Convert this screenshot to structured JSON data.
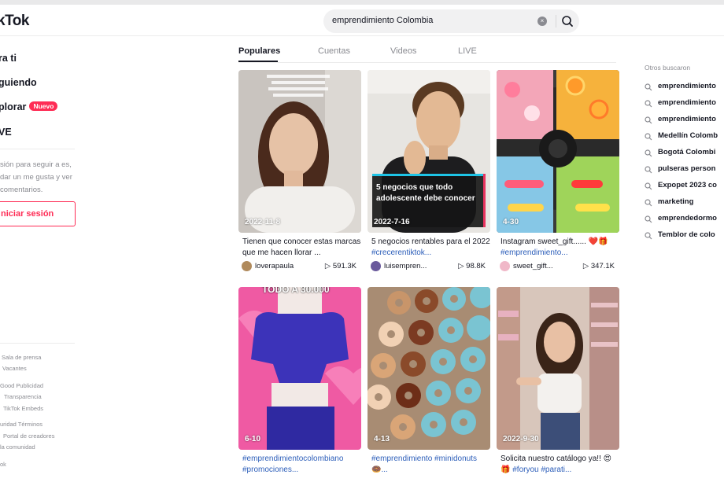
{
  "header": {
    "logo": "kTok",
    "search_value": "emprendimiento Colombia",
    "clear_glyph": "×"
  },
  "sidebar": {
    "nav": [
      {
        "label": "ra ti"
      },
      {
        "label": "guiendo"
      },
      {
        "label": "plorar",
        "badge": "Nuevo"
      },
      {
        "label": "VE"
      }
    ],
    "login_text": "sión para seguir a es, dar un me gusta y ver comentarios.",
    "login_button": "niciar sesión",
    "footer": [
      "Sala de prensa",
      "Vacantes",
      "Good Publicidad",
      "Transparencia",
      "TikTok Embeds",
      "uridad Términos",
      "Portal de creadores",
      "la comunidad",
      "ok"
    ]
  },
  "tabs": [
    {
      "label": "Populares",
      "active": true
    },
    {
      "label": "Cuentas",
      "active": false
    },
    {
      "label": "Videos",
      "active": false
    },
    {
      "label": "LIVE",
      "active": false
    }
  ],
  "cards": [
    {
      "date": "2022-11-8",
      "desc": "Tienen que conocer estas marcas que me hacen llorar ...",
      "author": "loverapaula",
      "views": "591.3K",
      "avatar_color": "#b08a5c"
    },
    {
      "date": "2022-7-16",
      "desc": "5 negocios rentables para el 2022 ",
      "desc_tag": "#crecerentiktok...",
      "author": "luisempren...",
      "views": "98.8K",
      "avatar_color": "#6a5a9c",
      "overlay": "5 negocios que todo adolescente debe conocer"
    },
    {
      "date": "4-30",
      "desc": "Instagram sweet_gift...... ❤️🎁 ",
      "desc_tag": "#emprendimiento...",
      "author": "sweet_gift...",
      "views": "347.1K",
      "avatar_color": "#f0b8c8"
    },
    {
      "date": "6-10",
      "desc": "",
      "desc_tag": "#emprendimientocolombiano #promociones...",
      "author": "",
      "views": "",
      "avatar_color": "#e9b7d0",
      "overlay": "TODO A 30.000"
    },
    {
      "date": "4-13",
      "desc": "",
      "desc_tag": "#emprendimiento #minidonuts🍩...",
      "author": "",
      "views": "",
      "avatar_color": "#9a7a5a"
    },
    {
      "date": "2022-9-30",
      "desc": "Solicita nuestro catálogo ya!! 😍🎁 ",
      "desc_tag": "#foryou #parati...",
      "author": "",
      "views": "",
      "avatar_color": "#c7a07a"
    }
  ],
  "views_prefix": "▷",
  "others": {
    "title": "Otros buscaron",
    "items": [
      "emprendimiento",
      "emprendimiento",
      "emprendimiento",
      "Medellín Colomb",
      "Bogotá Colombi",
      "pulseras person",
      "Expopet 2023 co",
      "marketing",
      "emprendedormo",
      "Temblor de colo"
    ]
  },
  "colors": {
    "accent": "#fe2c55",
    "hashtag": "#2b5db9",
    "text": "#161823",
    "muted": "#8a8b91"
  }
}
